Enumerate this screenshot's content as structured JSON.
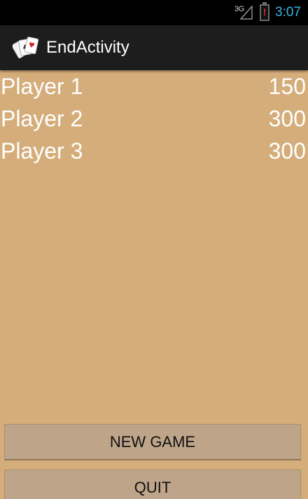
{
  "status_bar": {
    "network": "3G",
    "time": "3:07",
    "battery_alert": "!",
    "clock_color": "#33b5e5"
  },
  "action_bar": {
    "title": "EndActivity",
    "icon": "playing-cards-icon"
  },
  "players": [
    {
      "name": "Player 1",
      "score": "150"
    },
    {
      "name": "Player 2",
      "score": "300"
    },
    {
      "name": "Player 3",
      "score": "300"
    }
  ],
  "buttons": {
    "new_game": "NEW GAME",
    "quit": "QUIT"
  },
  "colors": {
    "background": "#d4ad7a",
    "button": "#bea58a"
  }
}
